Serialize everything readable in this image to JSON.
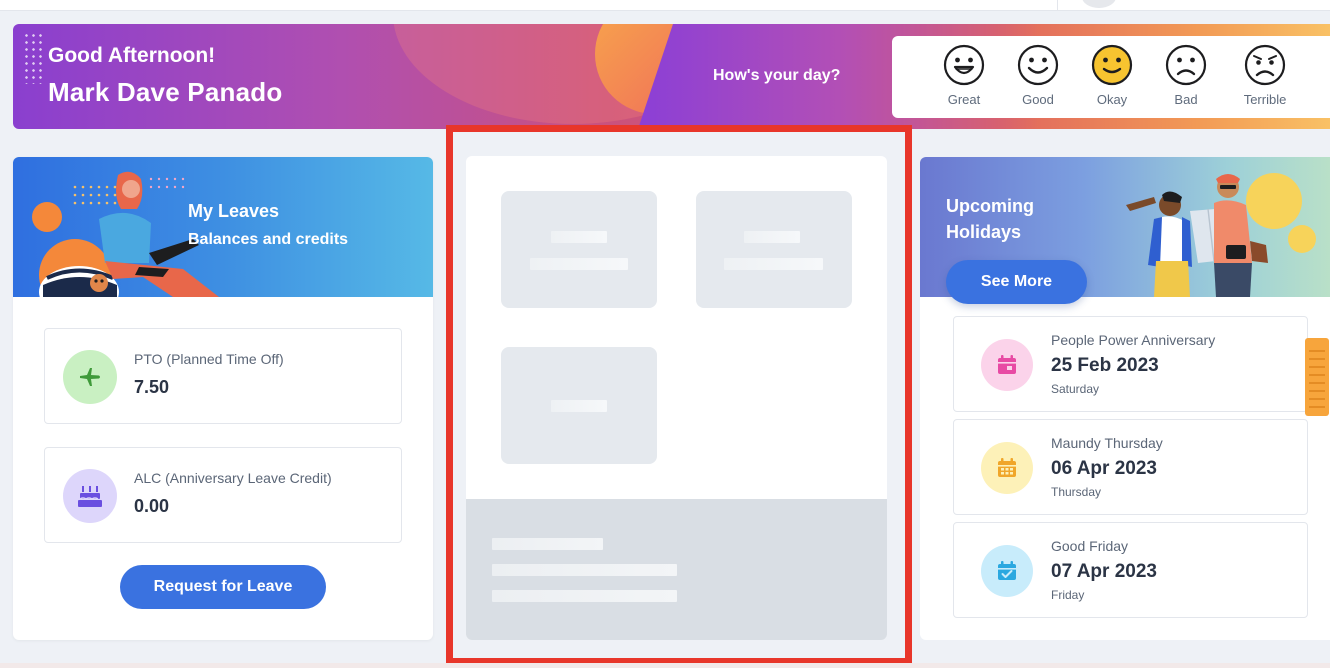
{
  "greeting": {
    "salutation": "Good Afternoon!",
    "name": "Mark Dave Panado",
    "prompt": "How's your day?"
  },
  "moods": [
    {
      "label": "Great",
      "icon": "grin-face-icon"
    },
    {
      "label": "Good",
      "icon": "smile-face-icon"
    },
    {
      "label": "Okay",
      "icon": "okay-face-icon",
      "selected": true
    },
    {
      "label": "Bad",
      "icon": "sad-face-icon"
    },
    {
      "label": "Terrible",
      "icon": "terrible-face-icon"
    }
  ],
  "leaves": {
    "title": "My Leaves",
    "subtitle": "Balances and credits",
    "items": [
      {
        "label": "PTO (Planned Time Off)",
        "value": "7.50",
        "icon": "airplane-icon"
      },
      {
        "label": "ALC (Anniversary Leave Credit)",
        "value": "0.00",
        "icon": "cake-icon"
      }
    ],
    "request_button": "Request for Leave"
  },
  "holidays": {
    "title": "Upcoming Holidays",
    "see_more": "See More",
    "items": [
      {
        "name": "People Power Anniversary",
        "date": "25 Feb 2023",
        "day": "Saturday",
        "icon": "calendar-icon"
      },
      {
        "name": "Maundy Thursday",
        "date": "06 Apr 2023",
        "day": "Thursday",
        "icon": "calendar-grid-icon"
      },
      {
        "name": "Good Friday",
        "date": "07 Apr 2023",
        "day": "Friday",
        "icon": "calendar-check-icon"
      }
    ]
  },
  "colors": {
    "accent": "#3a72e0",
    "highlight_border": "#e8362a",
    "okay_mood": "#f7c430"
  }
}
